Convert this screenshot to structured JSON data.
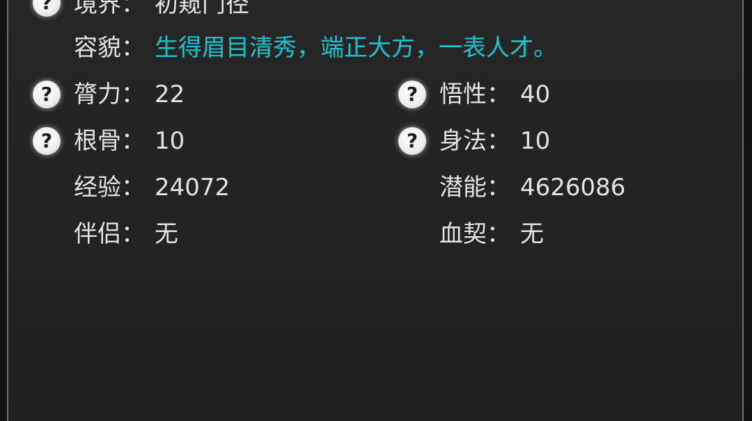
{
  "attributes": {
    "realm": {
      "label": "境界",
      "value": "初窥门径"
    },
    "appearance": {
      "label": "容貌",
      "value": "生得眉目清秀，端正大方，一表人才。",
      "value_color": "#18c4cc"
    },
    "strength": {
      "label": "膂力",
      "value": "22"
    },
    "comprehension": {
      "label": "悟性",
      "value": "40"
    },
    "constitution": {
      "label": "根骨",
      "value": "10"
    },
    "agility": {
      "label": "身法",
      "value": "10"
    },
    "experience": {
      "label": "经验",
      "value": "24072"
    },
    "potential": {
      "label": "潜能",
      "value": "4626086"
    },
    "partner": {
      "label": "伴侣",
      "value": "无"
    },
    "blood_pact": {
      "label": "血契",
      "value": "无"
    }
  },
  "separator": "：",
  "help_icon_glyph": "?"
}
